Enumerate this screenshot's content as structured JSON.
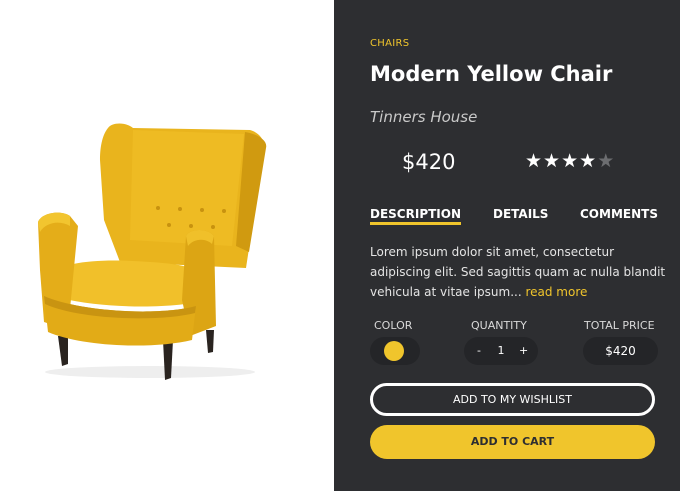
{
  "product": {
    "category": "CHAIRS",
    "title": "Modern Yellow Chair",
    "brand": "Tinners House",
    "price": "$420",
    "rating": 4,
    "rating_max": 5,
    "image_icon": "armchair-icon"
  },
  "tabs": {
    "description": "DESCRIPTION",
    "details": "DETAILS",
    "comments": "COMMENTS",
    "active": "description"
  },
  "description": {
    "text": "Lorem ipsum dolor sit amet, consectetur adipiscing elit. Sed sagittis quam ac nulla blandit vehicula at vitae ipsum...",
    "read_more": "read more"
  },
  "options": {
    "color_label": "COLOR",
    "quantity_label": "QUANTITY",
    "total_label": "TOTAL PRICE",
    "color_value": "#f0c52c",
    "quantity_minus": "-",
    "quantity": "1",
    "quantity_plus": "+",
    "total": "$420"
  },
  "buttons": {
    "wishlist": "ADD TO MY WISHLIST",
    "cart": "ADD TO CART"
  },
  "colors": {
    "panel_bg": "#2d2e31",
    "accent": "#f0c52c",
    "pill_bg": "#242528"
  }
}
